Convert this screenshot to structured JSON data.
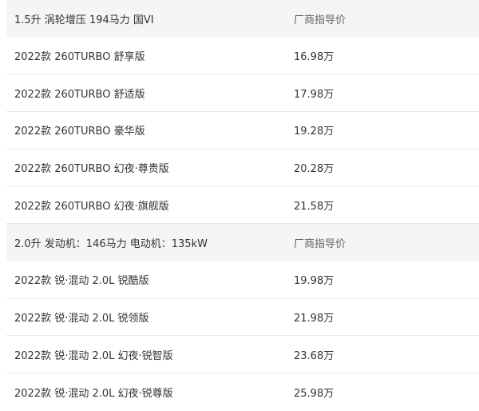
{
  "groups": [
    {
      "header": {
        "title": "1.5升 涡轮增压 194马力 国VI",
        "price_label": "厂商指导价"
      },
      "items": [
        {
          "name": "2022款 260TURBO 舒享版",
          "price": "16.98万"
        },
        {
          "name": "2022款 260TURBO 舒适版",
          "price": "17.98万"
        },
        {
          "name": "2022款 260TURBO 豪华版",
          "price": "19.28万"
        },
        {
          "name": "2022款 260TURBO 幻夜·尊贵版",
          "price": "20.28万"
        },
        {
          "name": "2022款 260TURBO 幻夜·旗舰版",
          "price": "21.58万"
        }
      ]
    },
    {
      "header": {
        "title": "2.0升 发动机：146马力 电动机：135kW",
        "price_label": "厂商指导价"
      },
      "items": [
        {
          "name": "2022款 锐·混动 2.0L 锐酷版",
          "price": "19.98万"
        },
        {
          "name": "2022款 锐·混动 2.0L 锐领版",
          "price": "21.98万"
        },
        {
          "name": "2022款 锐·混动 2.0L 幻夜·锐智版",
          "price": "23.68万"
        },
        {
          "name": "2022款 锐·混动 2.0L 幻夜·锐尊版",
          "price": "25.98万"
        }
      ]
    }
  ]
}
